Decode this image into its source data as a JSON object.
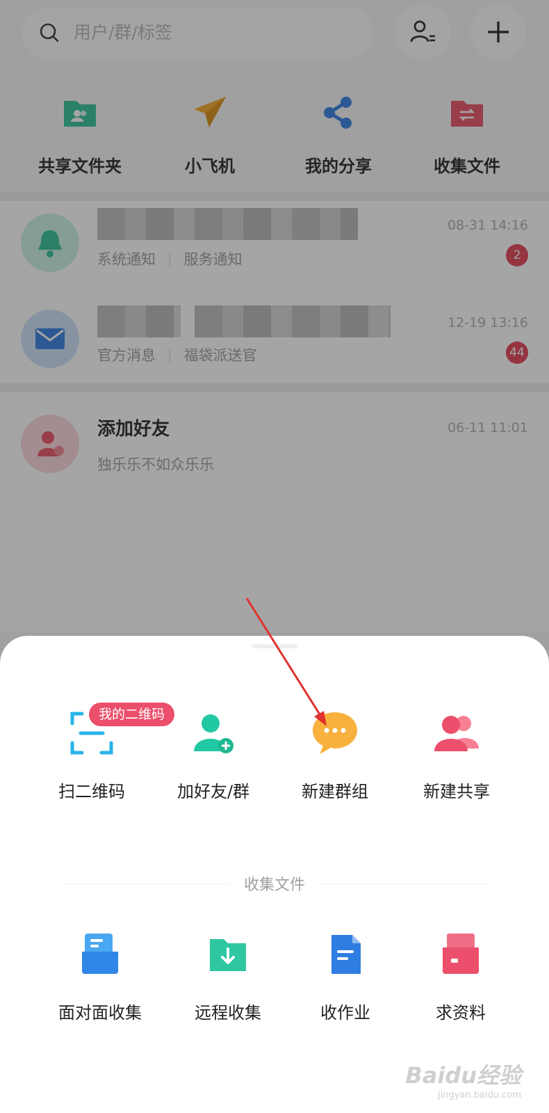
{
  "search": {
    "placeholder": "用户/群/标签",
    "icons": [
      "search-icon",
      "contacts-icon",
      "plus-icon"
    ]
  },
  "quick_actions": [
    {
      "label": "共享文件夹",
      "icon": "shared-folder-icon",
      "color": "#2dbf97"
    },
    {
      "label": "小飞机",
      "icon": "paper-plane-icon",
      "color": "#f5a623"
    },
    {
      "label": "我的分享",
      "icon": "share-icon",
      "color": "#2f7de1"
    },
    {
      "label": "收集文件",
      "icon": "collect-folder-icon",
      "color": "#e94f63"
    }
  ],
  "messages": [
    {
      "sub1": "系统通知",
      "sub2": "服务通知",
      "time": "08-31 14:16",
      "badge": "2",
      "icon": "bell-icon",
      "color": "#2dbf97"
    },
    {
      "sub1": "官方消息",
      "sub2": "福袋派送官",
      "time": "12-19 13:16",
      "badge": "44",
      "icon": "mail-icon",
      "color": "#2f7de1"
    },
    {
      "title": "添加好友",
      "sub1": "独乐乐不如众乐乐",
      "time": "06-11 11:01",
      "icon": "add-friend-icon",
      "color": "#e94f63"
    }
  ],
  "sheet": {
    "actions": [
      {
        "label": "扫二维码",
        "icon": "scan-qr-icon",
        "tag": "我的二维码"
      },
      {
        "label": "加好友/群",
        "icon": "add-friend-icon"
      },
      {
        "label": "新建群组",
        "icon": "chat-bubble-icon"
      },
      {
        "label": "新建共享",
        "icon": "group-share-icon"
      }
    ],
    "section_title": "收集文件",
    "collect": [
      {
        "label": "面对面收集",
        "icon": "face-collect-icon"
      },
      {
        "label": "远程收集",
        "icon": "remote-collect-icon"
      },
      {
        "label": "收作业",
        "icon": "homework-icon"
      },
      {
        "label": "求资料",
        "icon": "request-material-icon"
      }
    ]
  },
  "watermark": {
    "brand": "Baidu经验",
    "url": "jingyan.baidu.com"
  },
  "colors": {
    "accent_pink": "#ec4f6b",
    "arrow": "#e0322e",
    "overlay": "rgba(40,40,40,0.42)"
  }
}
